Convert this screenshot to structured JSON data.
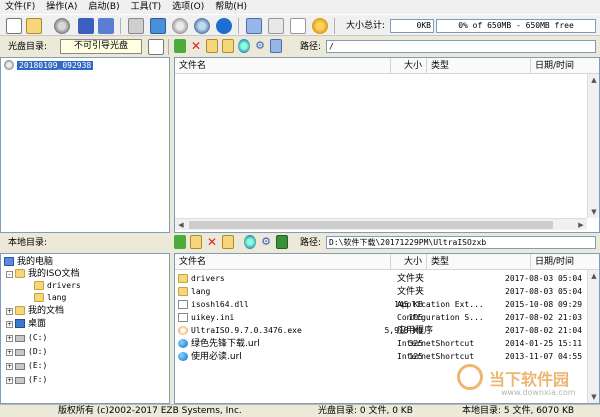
{
  "menu": [
    "文件(F)",
    "操作(A)",
    "启动(B)",
    "工具(T)",
    "选项(O)",
    "帮助(H)"
  ],
  "toolbar": {
    "total_size_label": "大小总计:",
    "total_size_value": "0KB",
    "capacity_text": "0% of 650MB - 650MB free"
  },
  "disc_bar": {
    "label": "光盘目录:",
    "boot_button": "不可引导光盘",
    "path_label": "路径:",
    "path_value": "/"
  },
  "disc_tree": {
    "root": "20180109_092938"
  },
  "disc_columns": [
    "文件名",
    "大小",
    "类型",
    "日期/时间"
  ],
  "local_bar": {
    "label": "本地目录:",
    "path_label": "路径:",
    "path_value": "D:\\软件下载\\20171229PM\\UltraISOzxb"
  },
  "local_tree": [
    {
      "label": "我的电脑",
      "icon": "computer-icon",
      "expander": ""
    },
    {
      "label": "我的ISO文档",
      "icon": "folder-icon",
      "expander": "-"
    },
    {
      "label": "drivers",
      "icon": "folder-icon",
      "expander": ""
    },
    {
      "label": "lang",
      "icon": "folder-icon",
      "expander": ""
    },
    {
      "label": "我的文档",
      "icon": "folder-icon",
      "expander": "+"
    },
    {
      "label": "桌面",
      "icon": "desktop-icon",
      "expander": "+"
    },
    {
      "label": "(C:)",
      "icon": "drive-icon",
      "expander": "+"
    },
    {
      "label": "(D:)",
      "icon": "drive-icon",
      "expander": "+"
    },
    {
      "label": "(E:)",
      "icon": "drive-icon",
      "expander": "+"
    },
    {
      "label": "(F:)",
      "icon": "drive-icon",
      "expander": "+"
    }
  ],
  "local_columns": [
    "文件名",
    "大小",
    "类型",
    "日期/时间"
  ],
  "local_files": [
    {
      "name": "drivers",
      "size": "",
      "type": "文件夹",
      "date": "2017-08-03 05:04",
      "icon": "folder-icon"
    },
    {
      "name": "lang",
      "size": "",
      "type": "文件夹",
      "date": "2017-08-03 05:04",
      "icon": "folder-icon"
    },
    {
      "name": "isoshl64.dll",
      "size": "145 KB",
      "type": "Application Ext...",
      "date": "2015-10-08 09:29",
      "icon": "dll-icon"
    },
    {
      "name": "uikey.ini",
      "size": "105",
      "type": "Configuration S...",
      "date": "2017-08-02 21:03",
      "icon": "ini-icon"
    },
    {
      "name": "UltraISO.9.7.0.3476.exe",
      "size": "5,918 KB",
      "type": "应用程序",
      "date": "2017-08-02 21:04",
      "icon": "exe-icon"
    },
    {
      "name": "绿色先锋下载.url",
      "size": "325",
      "type": "InternetShortcut",
      "date": "2014-01-25 15:11",
      "icon": "url-icon"
    },
    {
      "name": "使用必读.url",
      "size": "125",
      "type": "InternetShortcut",
      "date": "2013-11-07 04:55",
      "icon": "url-icon"
    }
  ],
  "status": {
    "copyright": "版权所有 (c)2002-2017 EZB Systems, Inc.",
    "disc_summary": "光盘目录: 0 文件, 0 KB",
    "local_summary": "本地目录: 5 文件, 6070 KB"
  },
  "watermark": {
    "title": "当下软件园",
    "url": "www.downxia.com"
  },
  "colors": {
    "selection": "#316ac5",
    "accent_orange": "#e07b00",
    "folder": "#f5d67a"
  }
}
